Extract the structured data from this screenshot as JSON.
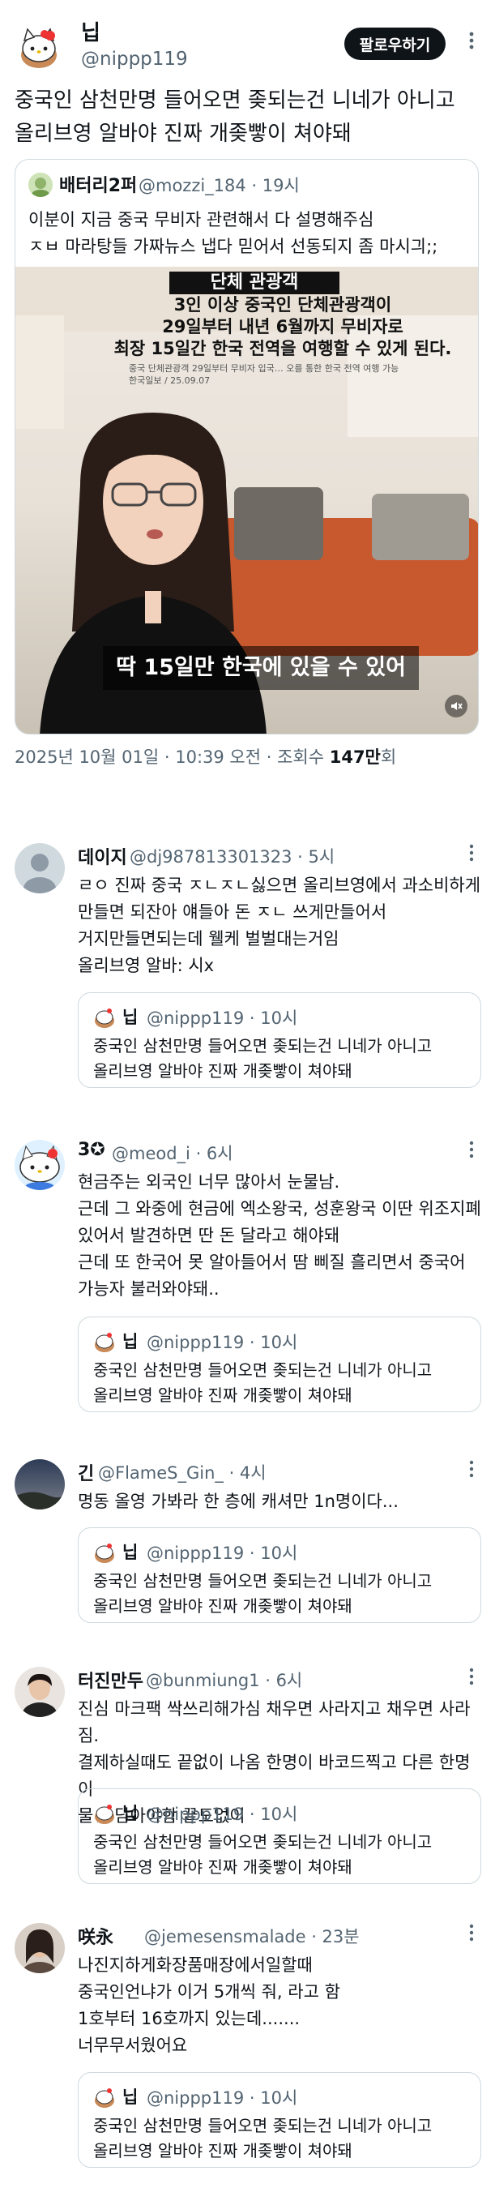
{
  "main": {
    "author_name": "닙",
    "author_handle": "@nippp119",
    "follow_label": "팔로우하기",
    "text": "중국인 삼천만명 들어오면 좆되는건 니네가 아니고\n올리브영 알바야 진짜 개좆빻이 쳐야돼",
    "quote": {
      "author_name": "배터리2퍼",
      "author_handle": "@mozzi_184 · 19시",
      "text": "이분이 지금 중국 무비자 관련해서 다 설명해주심\nㅈㅂ 마라탕들 가짜뉴스 냅다 믿어서 선동되지 좀 마시긔;;",
      "media": {
        "sign_partial": "단체 관광객",
        "headline": "3인 이상 중국인 단체관광객이\n29일부터 내년 6월까지 무비자로\n최장 15일간 한국 전역을 여행할 수 있게 된다.",
        "source": "중국 단체관광객 29일부터 무비자 입국… 오를 통한 한국 전역 여행 가능\n한국일보 / 25.09.07",
        "subtitle": "딱 15일만 한국에 있을 수 있어"
      }
    },
    "meta": "2025년 10월 01일 · 10:39 오전 · 조회수 ",
    "views": "147만",
    "views_suffix": "회"
  },
  "shared_quote": {
    "author_name": "닙",
    "author_handle": "@nippp119 · 10시",
    "text": "중국인 삼천만명 들어오면 좆되는건 니네가 아니고\n올리브영 알바야 진짜 개좆빻이 쳐야돼"
  },
  "replies": [
    {
      "name": "데이지",
      "handle": "@dj987813301323 · 5시",
      "text": "ㄹㅇ 진짜 중국 ㅈㄴㅈㄴ싫으면 올리브영에서 과소비하게\n만들면 되잔아 얘들아 돈 ㅈㄴ 쓰게만들어서\n거지만들면되는데 웰케 벌벌대는거임\n올리브영 알바: 시x"
    },
    {
      "name": "3✪",
      "handle": "@meod_i · 6시",
      "text": "현금주는 외국인 너무 많아서 눈물남.\n근데 그 와중에 현금에 엑소왕국, 성훈왕국 이딴 위조지폐\n있어서 발견하면 딴 돈 달라고 해야돼\n근데 또 한국어 못 알아들어서 땀 삐질 흘리면서 중국어\n가능자 불러와야돼.."
    },
    {
      "name": "긴",
      "handle": "@FlameS_Gin_ · 4시",
      "text": "명동 올영 가봐라 한 층에 캐셔만 1n명이다..."
    },
    {
      "name": "터진만두",
      "handle": "@bunmiung1 · 6시",
      "text": "진심 마크팩 싹쓰리해가심 채우면 사라지고 채우면 사라짐.\n결제하실때도 끝없이 나옴 한명이 바코드찍고 다른 한명이\n물건 담아야함 끝도없이"
    },
    {
      "name": "咲永",
      "handle": "@jemesensmalade · 23분",
      "text": "나진지하게화장품매장에서일할때\n중국인언냐가 이거 5개씩 줘, 라고 함\n1호부터 16호까지 있는데.......\n너무무서웠어요"
    }
  ],
  "colors": {
    "text": "#0f1419",
    "muted": "#536471",
    "border": "#cfd9de",
    "follow_bg": "#0f1419"
  }
}
